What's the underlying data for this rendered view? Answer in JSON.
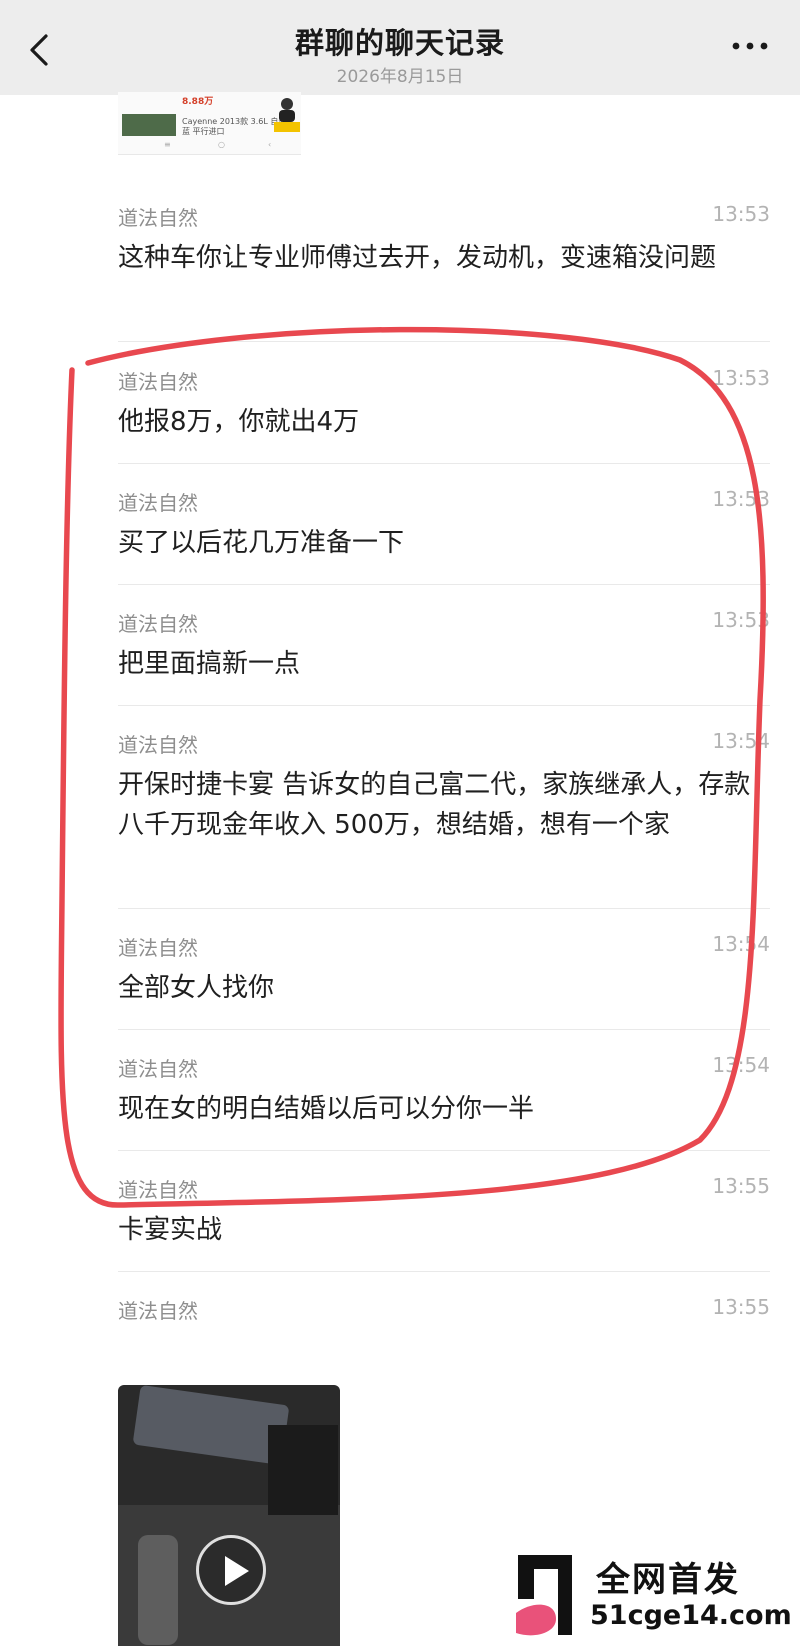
{
  "header": {
    "title": "群聊的聊天记录",
    "date": "2026年8月15日"
  },
  "top_card": {
    "price": "8.88万",
    "line1": "Cayenne 2013款 3.6L 自动",
    "line2": "蓝 平行进口"
  },
  "messages": [
    {
      "sender": "道法自然",
      "time": "13:53",
      "text": "这种车你让专业师傅过去开，发动机，变速箱没问题"
    },
    {
      "sender": "道法自然",
      "time": "13:53",
      "text": "他报8万，你就出4万"
    },
    {
      "sender": "道法自然",
      "time": "13:53",
      "text": "买了以后花几万准备一下"
    },
    {
      "sender": "道法自然",
      "time": "13:53",
      "text": "把里面搞新一点"
    },
    {
      "sender": "道法自然",
      "time": "13:54",
      "text": "开保时捷卡宴 告诉女的自己富二代，家族继承人，存款八千万现金年收入 500万，想结婚，想有一个家"
    },
    {
      "sender": "道法自然",
      "time": "13:54",
      "text": "全部女人找你"
    },
    {
      "sender": "道法自然",
      "time": "13:54",
      "text": "现在女的明白结婚以后可以分你一半"
    },
    {
      "sender": "道法自然",
      "time": "13:55",
      "text": "卡宴实战"
    },
    {
      "sender": "道法自然",
      "time": "13:55",
      "text": ""
    }
  ],
  "watermark": {
    "line1": "全网首发",
    "line2": "51cge14.com"
  },
  "colors": {
    "header_bg": "#ededed",
    "annotation_red": "#e8484f",
    "sender_gray": "#8e8e8e"
  },
  "icons": {
    "back": "chevron-left-icon",
    "more": "more-dots-icon",
    "play": "play-icon"
  }
}
